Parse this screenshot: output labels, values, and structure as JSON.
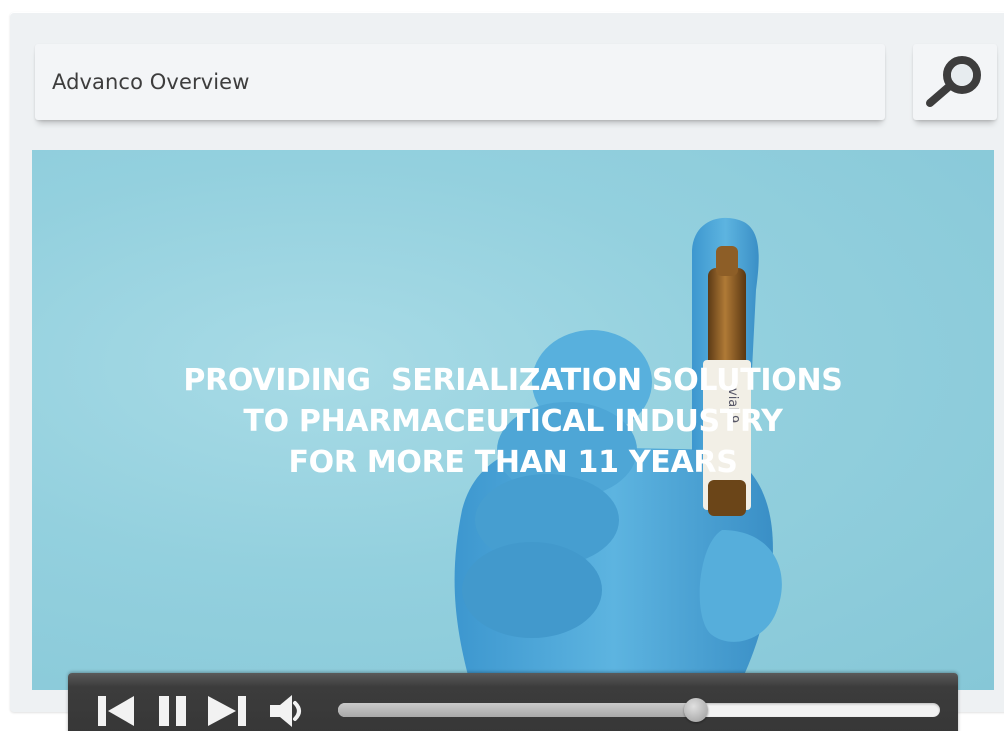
{
  "search": {
    "value": "Advanco Overview"
  },
  "video": {
    "headline": [
      "PROVIDING  SERIALIZATION SOLUTIONS",
      "TO PHARMACEUTICAL INDUSTRY",
      "FOR MORE THAN 11 YEARS"
    ],
    "ampoule_label": "vial 9"
  },
  "player": {
    "progress_fraction": 0.595,
    "buttons": [
      "previous-icon",
      "pause-icon",
      "next-icon",
      "volume-icon"
    ]
  },
  "icons": {
    "search": "magnifier-icon"
  },
  "colors": {
    "video_background": "#93d0de",
    "glove": "#4fa8d8",
    "controls": "#3c3c3c",
    "headline": "#ffffff"
  }
}
